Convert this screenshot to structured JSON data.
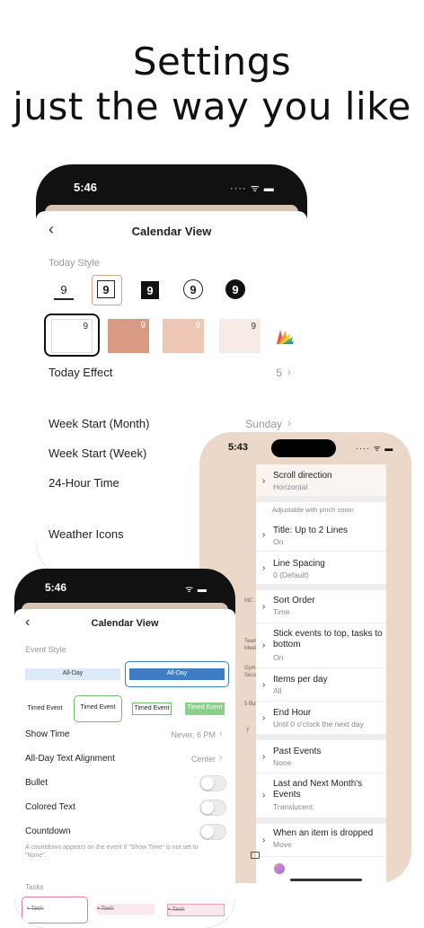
{
  "headline": {
    "line1": "Settings",
    "line2": "just the way you like"
  },
  "phone_back": {
    "time": "5:46",
    "status_icons": "···· ᯤ ▬",
    "nav_title": "Calendar View",
    "back_icon": "‹",
    "today_style_label": "Today Style",
    "day_styles": [
      "9",
      "9",
      "9",
      "9",
      "9"
    ],
    "swatch_digit": "9",
    "swatch_colors": [
      "#ffffff",
      "#d99a84",
      "#eec6b6",
      "#f8ebe6"
    ],
    "today_effect_label": "Today Effect",
    "today_effect_value": "5",
    "week_start_month_label": "Week Start (Month)",
    "week_start_month_value": "Sunday",
    "week_start_week_label": "Week Start (Week)",
    "hour24_label": "24-Hour Time",
    "weather_icons_label": "Weather Icons"
  },
  "phone_right": {
    "time": "5:43",
    "status_icons": "···· ᯤ ▬",
    "items": [
      {
        "title": "Scroll direction",
        "sub": "Horizontal"
      },
      {
        "title": "Title: Up to 2 Lines",
        "sub": "On"
      },
      {
        "title": "Line Spacing",
        "sub": "0 (Default)"
      },
      {
        "title": "Sort Order",
        "sub": "Time"
      },
      {
        "title": "Stick events to top, tasks to bottom",
        "sub": "On"
      },
      {
        "title": "Items per day",
        "sub": "All"
      },
      {
        "title": "End Hour",
        "sub": "Until 0 o'clock the next day"
      },
      {
        "title": "Past Events",
        "sub": "None"
      },
      {
        "title": "Last and Next Month's Events",
        "sub": "Translucent"
      },
      {
        "title": "When an item is dropped",
        "sub": "Move"
      }
    ],
    "pinch_hint": "Adjustable with pinch zoom",
    "side_texts": [
      "MC",
      "Team",
      "Meeti",
      "Gym",
      "Sessi",
      "5 Bui",
      "T"
    ]
  },
  "phone_left": {
    "time": "5:46",
    "status_icons": "ᯤ ▬",
    "nav_title": "Calendar View",
    "back_icon": "‹",
    "event_style_label": "Event Style",
    "allday_1": "All-Day",
    "allday_2": "All-Day",
    "timed": [
      "Timed Event",
      "Timed Event",
      "Timed Event",
      "Timed Event"
    ],
    "show_time_label": "Show Time",
    "show_time_value": "Never, 6 PM",
    "alignment_label": "All-Day Text Alignment",
    "alignment_value": "Center",
    "bullet_label": "Bullet",
    "colored_text_label": "Colored Text",
    "countdown_label": "Countdown",
    "countdown_note": "A countdown appears on the event if \"Show Time\" is not set to \"None\".",
    "tasks_label": "Tasks",
    "tasks": [
      "Task",
      "Task",
      "Task"
    ]
  },
  "colors": {
    "accent_blue": "#3e7cc4",
    "accent_green": "#6ebf6a",
    "swatch_peach": "#d99a84"
  }
}
